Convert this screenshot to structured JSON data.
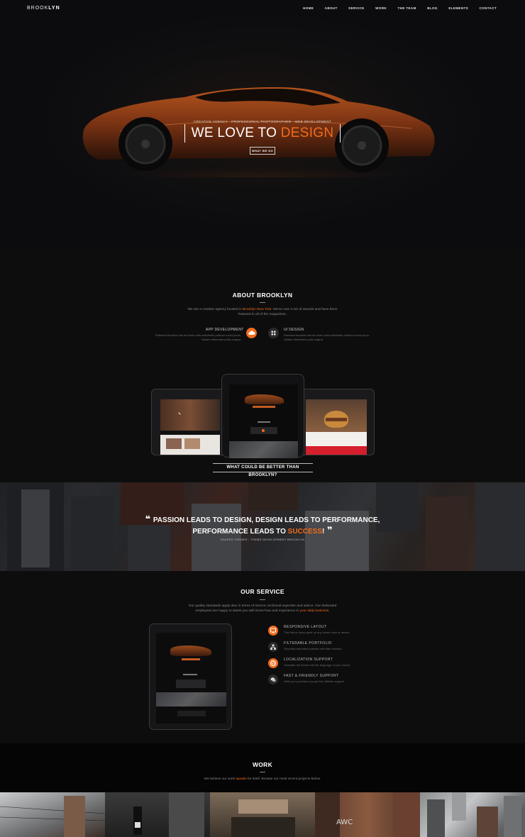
{
  "nav": {
    "logo_light": "BROOK",
    "logo_bold": "LYN",
    "items": [
      "HOME",
      "ABOUT",
      "SERVICE",
      "WORK",
      "THE TEAM",
      "BLOG",
      "ELEMENTS",
      "CONTACT"
    ]
  },
  "hero": {
    "subtitle": "CREATIVE AGENCY · PROFESSIONAL PHOTOGRAPHER · WEB DEVELOPMENT",
    "title_a": "WE LOVE TO ",
    "title_b": "DESIGN",
    "button": "WHAT WE DO"
  },
  "about": {
    "title": "ABOUT BROOKLYN",
    "text_a": "We are a creative agency located in ",
    "text_link": "Brooklyn New York",
    "text_b": ". We've won a ton of awards and have been",
    "text_c": "featured in all of the magazines.",
    "features": [
      {
        "title": "APP DEVELOPMENT",
        "line1": "Praesent faucibus nisl sit amet nulla sollicitudin pretium a sed purus.",
        "line2": "Nullam bibendum porta magna."
      },
      {
        "title": "UI DESIGN",
        "line1": "Praesent faucibus nisl sit amet nulla sollicitudin pretium a sed purus.",
        "line2": "Nullam bibendum porta magna."
      }
    ]
  },
  "showcase": {
    "banner": "WHAT COULD BE BETTER THAN BROOKLYN?"
  },
  "quote": {
    "line1": "PASSION LEADS TO DESIGN, DESIGN LEADS TO PERFORMANCE,",
    "line2_a": "PERFORMANCE LEADS TO ",
    "line2_b": "SUCCESS",
    "line2_c": "!",
    "author": "SHAPED THEMES - THEME DEVELOPMENT BROOKLYN"
  },
  "service": {
    "title": "OUR SERVICE",
    "text_a": "Our quality standards apply also in terms of service, technical expertise and advice. Our dedicated",
    "text_b": "employees are happy to assist you with know-how and experience in ",
    "text_link": "your daily business",
    "text_c": ".",
    "items": [
      {
        "title": "RESPONSIVE LAYOUT",
        "desc": "This theme looks great on any screen size or device."
      },
      {
        "title": "FILTERABLE PORTFOLIO",
        "desc": "Smoothly animated portfolio with filter function."
      },
      {
        "title": "LOCALIZATION SUPPORT",
        "desc": "Translate the theme into the language of your choice."
      },
      {
        "title": "FAST & FRIENDLY SUPPORT",
        "desc": "With your purchase you get free lifetime support."
      }
    ]
  },
  "work": {
    "title": "WORK",
    "text_a": "We believe our work ",
    "text_link": "speaks",
    "text_b": " for itself. Browse our most recent projects below."
  },
  "colors": {
    "accent": "#f26b1d",
    "background": "#0d0d0e"
  },
  "icons": {
    "app_development": "cloud-icon",
    "ui_design": "grid-icon",
    "responsive": "monitor-icon",
    "filterable": "sitemap-icon",
    "localization": "globe-icon",
    "support": "chat-icon"
  }
}
